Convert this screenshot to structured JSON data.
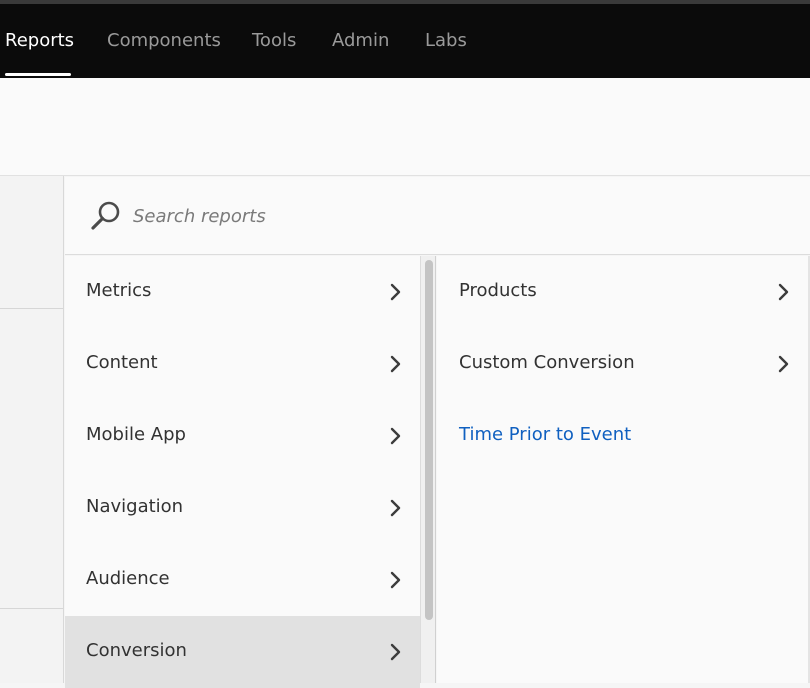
{
  "nav": {
    "items": [
      {
        "label": "Reports",
        "active": true
      },
      {
        "label": "Components",
        "active": false
      },
      {
        "label": "Tools",
        "active": false
      },
      {
        "label": "Admin",
        "active": false
      },
      {
        "label": "Labs",
        "active": false
      }
    ]
  },
  "search": {
    "placeholder": "Search reports",
    "icon": "search-icon"
  },
  "categories": [
    {
      "label": "Metrics",
      "selected": false
    },
    {
      "label": "Content",
      "selected": false
    },
    {
      "label": "Mobile App",
      "selected": false
    },
    {
      "label": "Navigation",
      "selected": false
    },
    {
      "label": "Audience",
      "selected": false
    },
    {
      "label": "Conversion",
      "selected": true
    }
  ],
  "subcategories": [
    {
      "label": "Products",
      "has_children": true
    },
    {
      "label": "Custom Conversion",
      "has_children": true
    },
    {
      "label": "Time Prior to Event",
      "has_children": false
    }
  ],
  "colors": {
    "nav_bg": "#0b0b0b",
    "link": "#1060c0",
    "selected_bg": "#e1e1e1"
  }
}
